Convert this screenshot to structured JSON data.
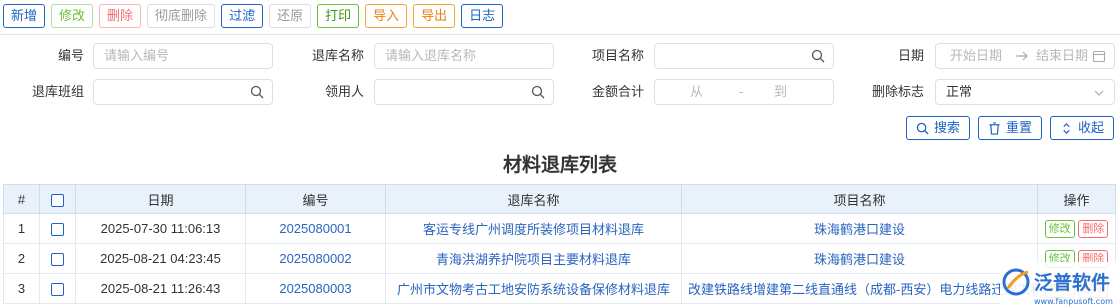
{
  "toolbar": {
    "add": "新增",
    "edit": "修改",
    "delete": "删除",
    "purge": "彻底删除",
    "filter": "过滤",
    "restore": "还原",
    "print": "打印",
    "import": "导入",
    "export": "导出",
    "log": "日志"
  },
  "filters": {
    "code_label": "编号",
    "code_placeholder": "请输入编号",
    "return_name_label": "退库名称",
    "return_name_placeholder": "请输入退库名称",
    "project_label": "项目名称",
    "date_label": "日期",
    "date_start": "开始日期",
    "date_end": "结束日期",
    "team_label": "退库班组",
    "receiver_label": "领用人",
    "amount_label": "金额合计",
    "amount_from": "从",
    "amount_dash": "-",
    "amount_to": "到",
    "deleted_label": "删除标志",
    "deleted_value": "正常"
  },
  "actions": {
    "search": "搜索",
    "reset": "重置",
    "collapse": "收起"
  },
  "list_title": "材料退库列表",
  "table": {
    "headers": [
      "#",
      "日期",
      "编号",
      "退库名称",
      "项目名称",
      "操作"
    ],
    "edit_label": "修改",
    "delete_label": "删除",
    "rows": [
      {
        "idx": "1",
        "date": "2025-07-30 11:06:13",
        "code": "2025080001",
        "name": "客运专线广州调度所装修项目材料退库",
        "project": "珠海鹤港口建设"
      },
      {
        "idx": "2",
        "date": "2025-08-21 04:23:45",
        "code": "2025080002",
        "name": "青海洪湖养护院项目主要材料退库",
        "project": "珠海鹤港口建设"
      },
      {
        "idx": "3",
        "date": "2025-08-21 11:26:43",
        "code": "2025080003",
        "name": "广州市文物考古工地安防系统设备保修材料退库",
        "project": "改建铁路线增建第二线直通线（成都-西安）电力线路迁改工程"
      }
    ]
  },
  "watermark": {
    "text": "泛普软件",
    "url": "www.fanpusoft.com"
  },
  "colors": {
    "accent": "#1d63c5",
    "header_bg": "#e9f1fb",
    "link": "#2a64c0"
  }
}
